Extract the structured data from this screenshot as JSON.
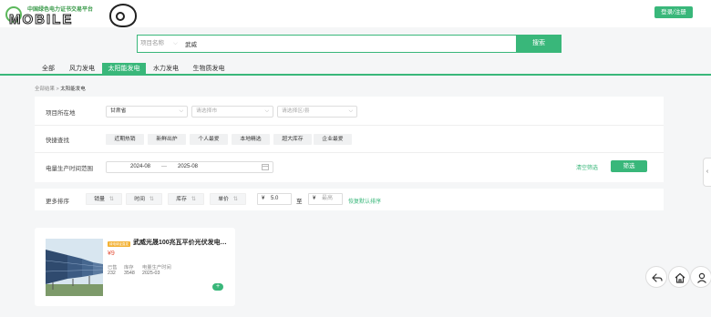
{
  "header": {
    "logo_cn": "中国绿色电力证书交易平台",
    "logo_en": "MOBILE",
    "login_label": "登录/注册"
  },
  "search": {
    "category": "项目名称",
    "value": "武威",
    "button": "搜索"
  },
  "tabs": [
    {
      "label": "全部",
      "active": false
    },
    {
      "label": "风力发电",
      "active": false
    },
    {
      "label": "太阳能发电",
      "active": true
    },
    {
      "label": "水力发电",
      "active": false
    },
    {
      "label": "生物质发电",
      "active": false
    }
  ],
  "breadcrumb": {
    "root": "全部结果",
    "sep": ">",
    "current": "太阳能发电"
  },
  "filters": {
    "location_label": "项目所在地",
    "province": "甘肃省",
    "city_placeholder": "请选择市",
    "district_placeholder": "请选择区/县",
    "quick_label": "快捷查找",
    "quick_chips": [
      "近期热销",
      "新鲜出炉",
      "个人最爱",
      "本地精选",
      "超大库存",
      "企业最爱"
    ],
    "time_label": "电量生产时间范围",
    "date_from": "2024-08",
    "date_sep": "—",
    "date_to": "2025-08",
    "clear_label": "清空筛选",
    "filter_label": "筛选"
  },
  "sort": {
    "label": "更多排序",
    "options": [
      "销量",
      "时间",
      "库存",
      "单价"
    ],
    "currency": "¥",
    "price_from": "5.0",
    "range_sep": "至",
    "price_to_placeholder": "最高",
    "default_link": "恢复默认排序"
  },
  "card": {
    "badge": "绿电绿证直发",
    "title": "武威光晟100兆瓦平价光伏发电项目",
    "price": "¥9",
    "stats": [
      {
        "label": "已售",
        "value": "232"
      },
      {
        "label": "库存",
        "value": "3548"
      },
      {
        "label": "电量生产时间",
        "value": "2025-03"
      }
    ],
    "add": "+"
  },
  "colors": {
    "accent": "#39b77a",
    "price": "#e5533c",
    "badge": "#f3b235"
  }
}
